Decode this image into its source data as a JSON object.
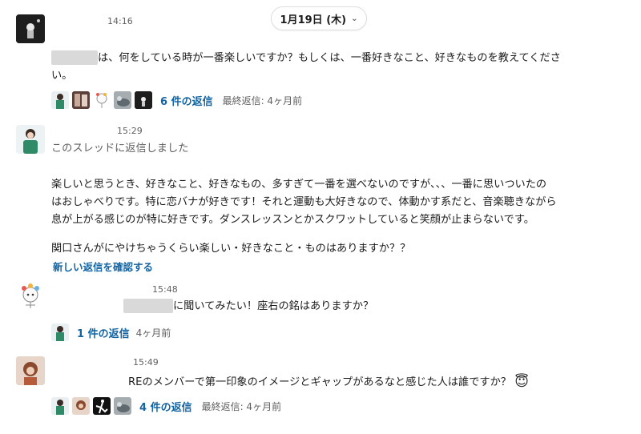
{
  "date_divider": {
    "label": "1月19日 (木)",
    "chevron": "chevron-down-icon"
  },
  "messages": [
    {
      "time": "14:16",
      "body_line1": "は、何をしている時が一番楽しいですか？もしくは、一番好きなこと、好きなものを教えてくださ",
      "body_line2": "い。",
      "replies": {
        "label": "6 件の返信",
        "meta": "最終返信: 4ヶ月前"
      }
    },
    {
      "time": "15:29",
      "subtitle": "このスレッドに返信しました",
      "body_line1": "楽しいと思うとき、好きなこと、好きなもの、多すぎて一番を選べないのですが、、、一番に思いついたの",
      "body_line2": "はおしゃべりです。特に恋バナが好きです！それと運動も大好きなので、体動かす系だと、音楽聴きながら",
      "body_line3": "息が上がる感じのが特に好きです。ダンスレッスンとかスクワットしていると笑顔が止まらないです。",
      "body_line4": "関口さんがにやけちゃうくらい楽しい・好きなこと・ものはありますか？？",
      "new_replies_link": "新しい返信を確認する"
    },
    {
      "time": "15:48",
      "body_line1": "に聞いてみたい！座右の銘はありますか？",
      "replies": {
        "label": "1 件の返信",
        "meta": "4ヶ月前"
      }
    },
    {
      "time": "15:49",
      "body_line1": "REのメンバーで第一印象のイメージとギャップがあるなと感じた人は誰ですか？",
      "emoji": "😇",
      "replies": {
        "label": "4 件の返信",
        "meta": "最終返信: 4ヶ月前"
      }
    }
  ]
}
